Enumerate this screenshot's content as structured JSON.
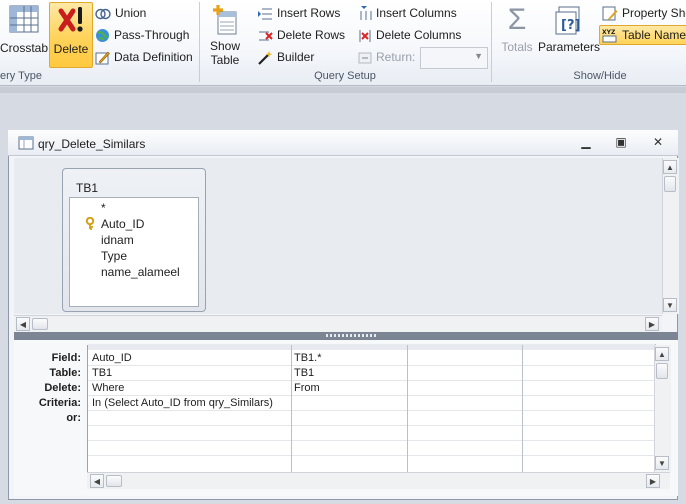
{
  "ribbon": {
    "query_type": {
      "label": "ery Type",
      "crosstab": "Crosstab",
      "delete": "Delete",
      "union": "Union",
      "pass_through": "Pass-Through",
      "data_definition": "Data Definition"
    },
    "query_setup": {
      "label": "Query Setup",
      "show_table_line1": "Show",
      "show_table_line2": "Table",
      "insert_rows": "Insert Rows",
      "delete_rows": "Delete Rows",
      "builder": "Builder",
      "insert_columns": "Insert Columns",
      "delete_columns": "Delete Columns",
      "return": "Return:",
      "return_value": ""
    },
    "show_hide": {
      "label": "Show/Hide",
      "totals": "Totals",
      "parameters": "Parameters",
      "property_sheet": "Property She",
      "table_names": "Table Names"
    }
  },
  "query_window": {
    "title": "qry_Delete_Similars",
    "table": {
      "name": "TB1",
      "fields": [
        "*",
        "Auto_ID",
        "idnam",
        "Type",
        "name_alameel"
      ]
    },
    "grid": {
      "row_labels": [
        "Field:",
        "Table:",
        "Delete:",
        "Criteria:",
        "or:"
      ],
      "columns": [
        {
          "field": "Auto_ID",
          "table": "TB1",
          "delete": "Where",
          "criteria": "In (Select Auto_ID from qry_Similars)",
          "or": ""
        },
        {
          "field": "TB1.*",
          "table": "TB1",
          "delete": "From",
          "criteria": "",
          "or": ""
        },
        {
          "field": "",
          "table": "",
          "delete": "",
          "criteria": "",
          "or": ""
        },
        {
          "field": "",
          "table": "",
          "delete": "",
          "criteria": "",
          "or": ""
        }
      ]
    }
  },
  "colors": {
    "active_button": "#ffd35a",
    "splitter": "#7b8594",
    "key_icon": "#d4a017"
  }
}
